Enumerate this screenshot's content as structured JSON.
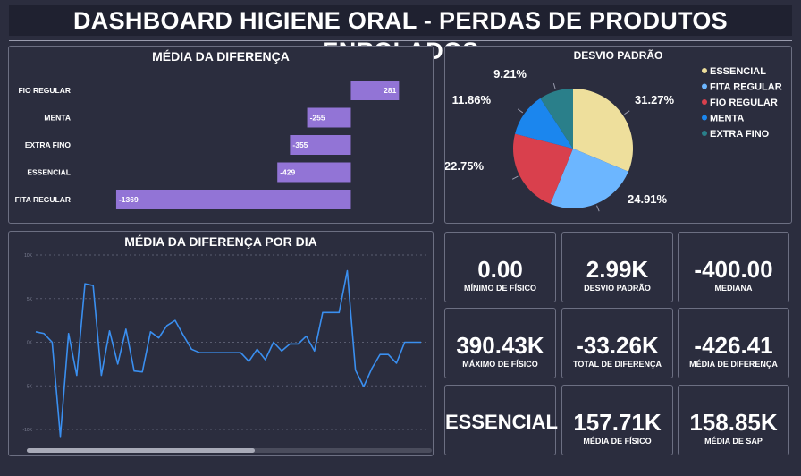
{
  "header": {
    "title": "DASHBOARD HIGIENE ORAL - PERDAS DE PRODUTOS ENROLADOS"
  },
  "bar_panel": {
    "title": "MÉDIA DA DIFERENÇA"
  },
  "pie_panel": {
    "title": "DESVIO PADRÃO"
  },
  "line_panel": {
    "title": "MÉDIA DA DIFERENÇA POR DIA"
  },
  "kpis": [
    {
      "value": "0.00",
      "label": "MÍNIMO DE FÍSICO"
    },
    {
      "value": "2.99K",
      "label": "DESVIO PADRÃO"
    },
    {
      "value": "-400.00",
      "label": "MEDIANA"
    },
    {
      "value": "390.43K",
      "label": "MÁXIMO DE FÍSICO"
    },
    {
      "value": "-33.26K",
      "label": "TOTAL DE DIFERENÇA"
    },
    {
      "value": "-426.41",
      "label": "MÉDIA DE DIFERENÇA"
    },
    {
      "value": "ESSENCIAL",
      "label": ""
    },
    {
      "value": "157.71K",
      "label": "MÉDIA DE FÍSICO"
    },
    {
      "value": "158.85K",
      "label": "MÉDIA DE SAP"
    }
  ],
  "colors": {
    "bar": "#9274d6",
    "line": "#3a8ff0",
    "background": "#2b2d3e"
  },
  "chart_data": [
    {
      "type": "bar",
      "orientation": "horizontal",
      "title": "MÉDIA DA DIFERENÇA",
      "categories": [
        "FIO REGULAR",
        "MENTA",
        "EXTRA FINO",
        "ESSENCIAL",
        "FITA REGULAR"
      ],
      "values": [
        281,
        -255,
        -355,
        -429,
        -1369
      ],
      "value_labels": [
        "281",
        "-255",
        "-355",
        "-429",
        "-1369"
      ],
      "xlim": [
        -1400,
        300
      ]
    },
    {
      "type": "pie",
      "title": "DESVIO PADRÃO",
      "categories": [
        "ESSENCIAL",
        "FITA REGULAR",
        "FIO REGULAR",
        "MENTA",
        "EXTRA FINO"
      ],
      "values": [
        31.27,
        24.91,
        22.75,
        11.86,
        9.21
      ],
      "value_labels": [
        "31.27%",
        "24.91%",
        "22.75%",
        "11.86%",
        "9.21%"
      ],
      "colors": [
        "#eedf9c",
        "#6cb6ff",
        "#d9404d",
        "#1b86ee",
        "#2a7f8a"
      ],
      "legend": "right"
    },
    {
      "type": "line",
      "title": "MÉDIA DA DIFERENÇA POR DIA",
      "y_ticks": [
        "10K",
        "5K",
        "0K",
        "-5K",
        "-10K"
      ],
      "ylim": [
        -10000,
        10000
      ],
      "grid": true,
      "values": [
        1200,
        1000,
        0,
        -10800,
        1000,
        -3800,
        6700,
        6500,
        -3800,
        1300,
        -2500,
        1500,
        -3300,
        -3400,
        1200,
        500,
        1900,
        2500,
        800,
        -800,
        -1200,
        -1200,
        -1200,
        -1200,
        -1200,
        -1200,
        -2200,
        -800,
        -2000,
        0,
        -1000,
        -200,
        -200,
        700,
        -1000,
        3400,
        3400,
        3400,
        8200,
        -3200,
        -5100,
        -3000,
        -1400,
        -1400,
        -2400,
        0,
        0,
        0
      ]
    }
  ]
}
